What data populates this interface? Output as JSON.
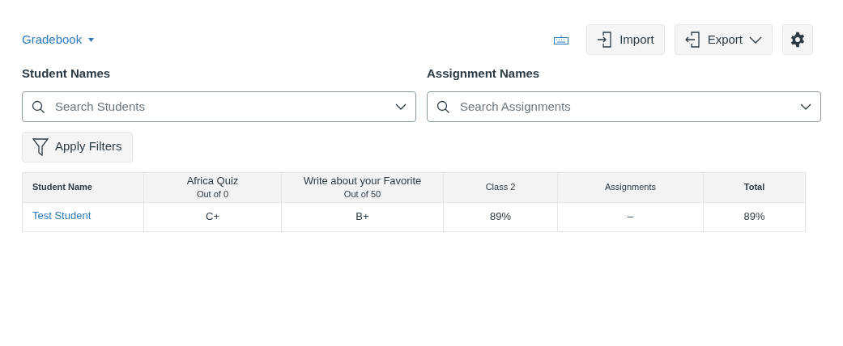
{
  "gradebook_menu": {
    "label": "Gradebook"
  },
  "toolbar": {
    "import_label": "Import",
    "export_label": "Export"
  },
  "filters": [
    {
      "label": "Student Names",
      "placeholder": "Search Students"
    },
    {
      "label": "Assignment Names",
      "placeholder": "Search Assignments"
    }
  ],
  "apply_filters": "Apply Filters",
  "table": {
    "columns": [
      {
        "kind": "student",
        "title": "Student Name"
      },
      {
        "kind": "assignment",
        "title": "Africa Quiz",
        "subtitle": "Out of 0"
      },
      {
        "kind": "assignment",
        "title": "Write about your Favorite",
        "subtitle": "Out of 50"
      },
      {
        "kind": "group",
        "title": "Class 2"
      },
      {
        "kind": "group",
        "title": "Assignments"
      },
      {
        "kind": "total",
        "title": "Total"
      }
    ],
    "rows": [
      {
        "cells": [
          "Test Student",
          "C+",
          "B+",
          "89%",
          "–",
          "89%"
        ]
      }
    ]
  }
}
